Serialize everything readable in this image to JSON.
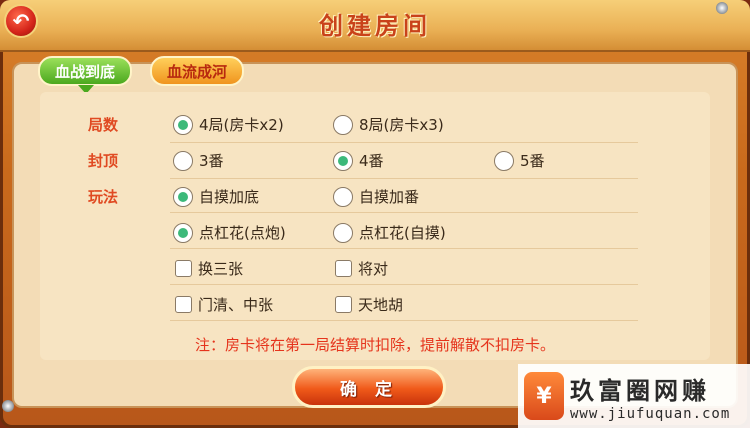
{
  "dialog": {
    "title": "创建房间",
    "back_icon": "back-arrow-icon"
  },
  "tabs": [
    {
      "label": "血战到底",
      "active": true
    },
    {
      "label": "血流成河",
      "active": false
    }
  ],
  "rounds": {
    "label": "局数",
    "options": [
      {
        "label": "4局(房卡x2)",
        "selected": true
      },
      {
        "label": "8局(房卡x3)",
        "selected": false
      }
    ]
  },
  "cap": {
    "label": "封顶",
    "options": [
      {
        "label": "3番",
        "selected": false
      },
      {
        "label": "4番",
        "selected": true
      },
      {
        "label": "5番",
        "selected": false
      }
    ]
  },
  "rules": {
    "label": "玩法",
    "self_draw": [
      {
        "label": "自摸加底",
        "selected": true
      },
      {
        "label": "自摸加番",
        "selected": false
      }
    ],
    "kong_flower": [
      {
        "label": "点杠花(点炮)",
        "selected": true
      },
      {
        "label": "点杠花(自摸)",
        "selected": false
      }
    ],
    "checkboxes": [
      {
        "label": "换三张",
        "checked": false
      },
      {
        "label": "将对",
        "checked": false
      },
      {
        "label": "门清、中张",
        "checked": false
      },
      {
        "label": "天地胡",
        "checked": false
      }
    ]
  },
  "note": "注：房卡将在第一局结算时扣除，提前解散不扣房卡。",
  "confirm_label": "确 定",
  "watermark": {
    "logo_char": "¥",
    "name": "玖富圈网赚",
    "url": "www.jiufuquan.com"
  },
  "colors": {
    "accent_red": "#e04a22",
    "radio_selected": "#3cb97a",
    "tab_active": "#4ba81e",
    "tab_inactive": "#f0941e"
  }
}
